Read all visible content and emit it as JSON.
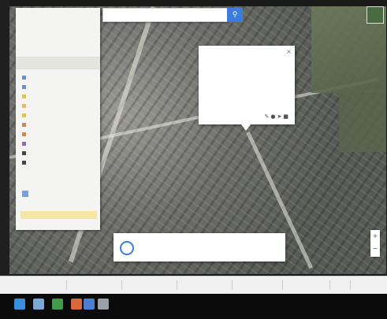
{
  "search": {
    "placeholder": ""
  },
  "sidepanel": {
    "title": "",
    "subtitle": "",
    "meta": "",
    "layer_header": "",
    "layers": [
      {
        "label": "",
        "color": "#6a8fd0"
      },
      {
        "label": "",
        "color": "#6a8fd0"
      },
      {
        "label": "",
        "color": "#e0c060"
      },
      {
        "label": "",
        "color": "#e0c060"
      },
      {
        "label": "",
        "color": "#e0c060"
      },
      {
        "label": "",
        "color": "#c98a5a"
      },
      {
        "label": "",
        "color": "#c98a5a"
      },
      {
        "label": "",
        "color": "#8a6fb0"
      },
      {
        "label": "",
        "color": "#444444"
      },
      {
        "label": "",
        "color": "#444444"
      }
    ],
    "base_layer_label": "",
    "note": ""
  },
  "infowindow": {
    "title": "",
    "body": "",
    "footer": ""
  },
  "notification": {
    "text": "",
    "subtext": "",
    "link": ""
  },
  "downloads": {
    "tabs": [
      "",
      "",
      "",
      "",
      "",
      "",
      ""
    ],
    "show_all": ""
  },
  "taskbar": {
    "clock": "",
    "icons": [
      {
        "name": "start-icon",
        "color": "#3a8fd8"
      },
      {
        "name": "explorer-icon",
        "color": "#7aa9d8"
      },
      {
        "name": "browser-icon",
        "color": "#3d9d4a"
      },
      {
        "name": "media-icon",
        "color": "#d86a3a"
      },
      {
        "name": "app-icon",
        "color": "#4a7fd0"
      },
      {
        "name": "app2-icon",
        "color": "#9aa0a8"
      }
    ]
  },
  "colors": {
    "accent": "#3b7ddd",
    "note_bg": "#f3e6a8"
  }
}
